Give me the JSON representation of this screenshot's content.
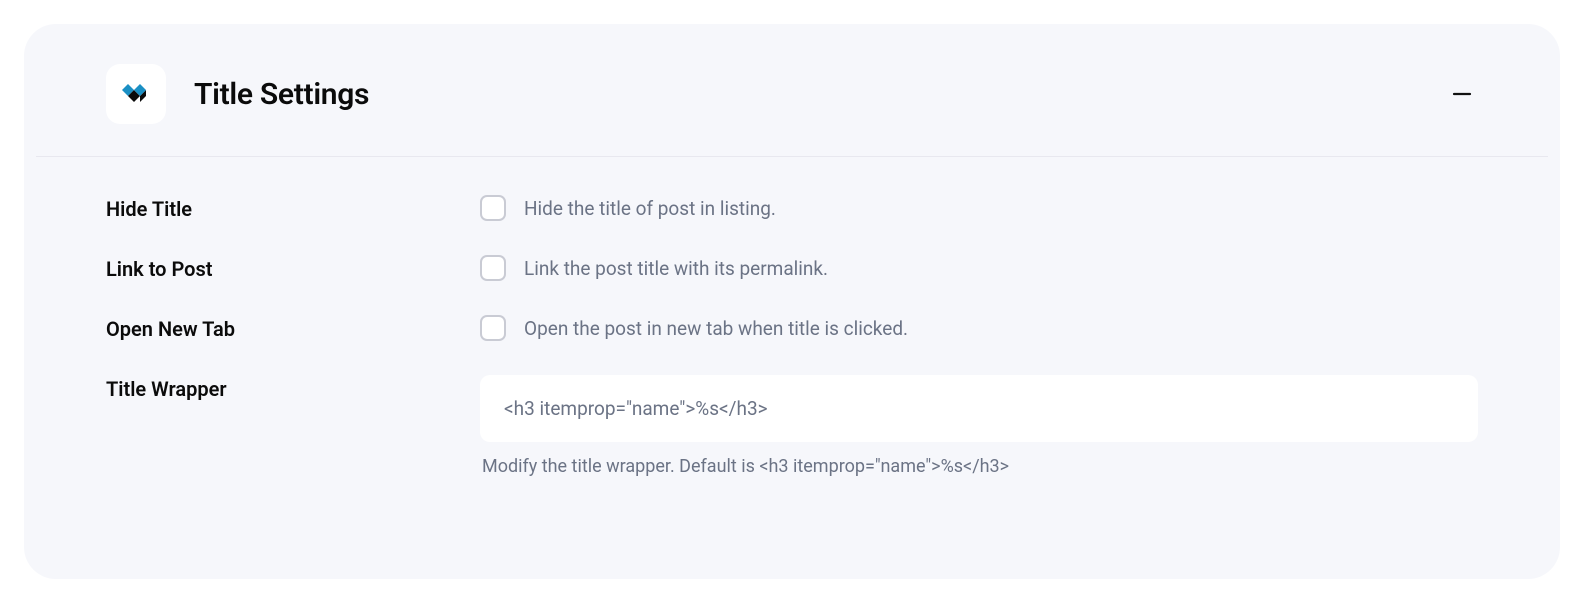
{
  "panel": {
    "title": "Title Settings",
    "rows": {
      "hide_title": {
        "label": "Hide Title",
        "desc": "Hide the title of post in listing."
      },
      "link_to_post": {
        "label": "Link to Post",
        "desc": "Link the post title with its permalink."
      },
      "open_new_tab": {
        "label": "Open New Tab",
        "desc": "Open the post in new tab when title is clicked."
      },
      "title_wrapper": {
        "label": "Title Wrapper",
        "value": "<h3 itemprop=\"name\">%s</h3>",
        "helper": "Modify the title wrapper. Default is <h3 itemprop=\"name\">%s</h3>"
      }
    }
  }
}
